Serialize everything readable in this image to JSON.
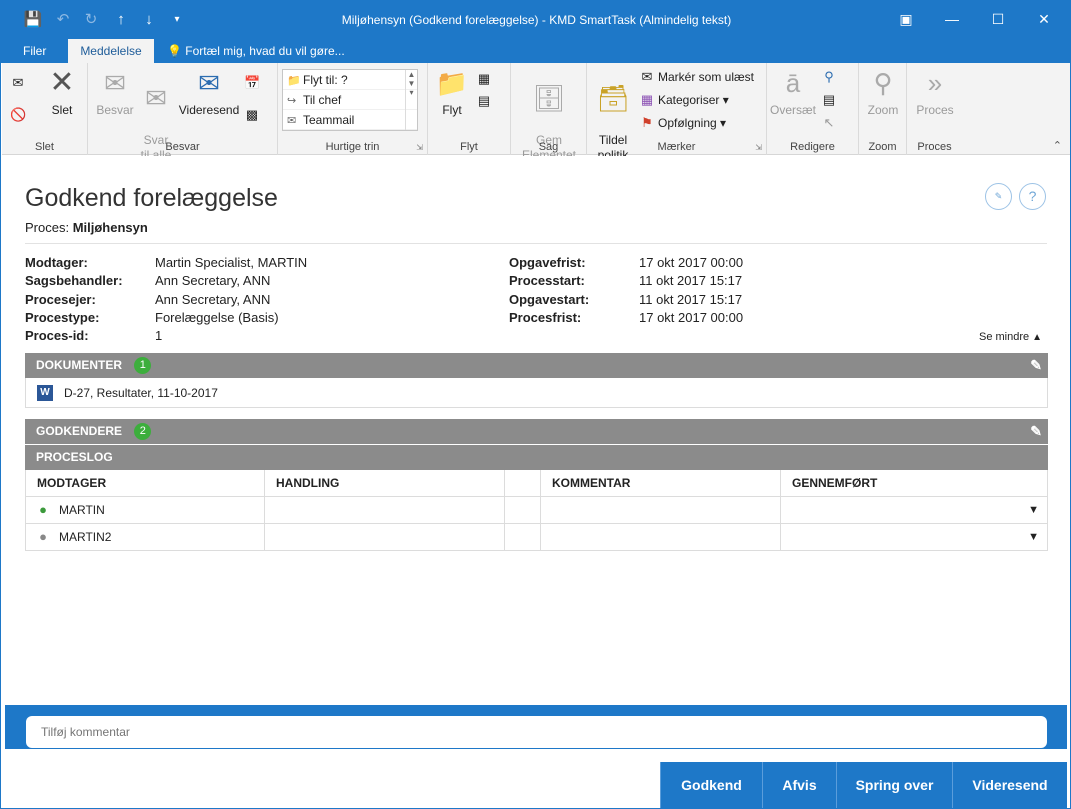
{
  "window": {
    "title": "Miljøhensyn (Godkend forelæggelse) - KMD SmartTask (Almindelig tekst)"
  },
  "ribbon_tabs": [
    {
      "label": "Filer"
    },
    {
      "label": "Meddelelse"
    }
  ],
  "tell_me": "Fortæl mig, hvad du vil gøre...",
  "ribbon": {
    "slet": {
      "label": "Slet",
      "delete_button": "Slet"
    },
    "besvar": {
      "label": "Besvar",
      "besvar": "Besvar",
      "svar_til_alle": "Svar\ntil alle",
      "videresend": "Videresend"
    },
    "hurtige_trin": {
      "label": "Hurtige trin",
      "items": [
        "Flyt til: ?",
        "Til chef",
        "Teammail"
      ]
    },
    "flyt": {
      "label": "Flyt",
      "flyt": "Flyt"
    },
    "sag": {
      "label": "Sag",
      "gem": "Gem\nElementet"
    },
    "maerker": {
      "label": "Mærker",
      "tildel": "Tildel\npolitik",
      "mark_unread": "Markér som ulæst",
      "kategoriser": "Kategoriser",
      "opfoelgning": "Opfølgning"
    },
    "rediger": {
      "label": "Redigere",
      "oversaet": "Oversæt"
    },
    "zoom": {
      "label": "Zoom",
      "zoom": "Zoom"
    },
    "proces": {
      "label": "Proces",
      "proces": "Proces"
    }
  },
  "task": {
    "title": "Godkend forelæggelse",
    "process_label": "Proces:",
    "process_name": "Miljøhensyn"
  },
  "meta_left": [
    {
      "key": "Modtager:",
      "value": "Martin Specialist, MARTIN"
    },
    {
      "key": "Sagsbehandler:",
      "value": "Ann Secretary, ANN"
    },
    {
      "key": "Procesejer:",
      "value": "Ann Secretary, ANN"
    },
    {
      "key": "Procestype:",
      "value": "Forelæggelse (Basis)"
    },
    {
      "key": "Proces-id:",
      "value": "1"
    }
  ],
  "meta_right": [
    {
      "key": "Opgavefrist:",
      "value": "17 okt 2017 00:00"
    },
    {
      "key": "Processtart:",
      "value": "11 okt 2017 15:17"
    },
    {
      "key": "Opgavestart:",
      "value": "11 okt 2017 15:17"
    },
    {
      "key": "Procesfrist:",
      "value": "17 okt 2017 00:00"
    }
  ],
  "see_less": "Se mindre",
  "documents": {
    "title": "DOKUMENTER",
    "count": "1",
    "items": [
      {
        "icon": "W",
        "name": "D-27, Resultater, 11-10-2017"
      }
    ]
  },
  "approvers": {
    "title": "GODKENDERE",
    "count": "2"
  },
  "process_log": {
    "title": "PROCESLOG",
    "columns": [
      "MODTAGER",
      "HANDLING",
      "",
      "KOMMENTAR",
      "GENNEMFØRT"
    ],
    "rows": [
      {
        "recipient": "MARTIN",
        "status": "active",
        "cells": []
      },
      {
        "recipient": "MARTIN2",
        "status": "pending",
        "cells": []
      }
    ]
  },
  "comment": {
    "placeholder": "Tilføj kommentar"
  },
  "actions": [
    {
      "label": "Godkend"
    },
    {
      "label": "Afvis"
    },
    {
      "label": "Spring over"
    },
    {
      "label": "Videresend"
    }
  ],
  "colors": {
    "accent": "#1e78c8",
    "section_bar": "#8b8b8b",
    "badge": "#3cae3c"
  }
}
